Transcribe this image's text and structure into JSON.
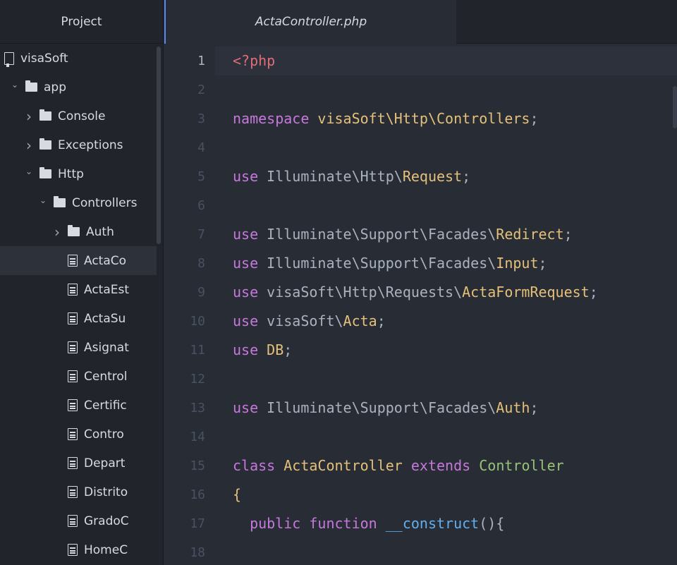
{
  "sidebar": {
    "title": "Project",
    "tree": [
      {
        "label": "visaSoft",
        "kind": "repo",
        "depth": 0,
        "expanded": null
      },
      {
        "label": "app",
        "kind": "folder",
        "depth": 1,
        "expanded": true
      },
      {
        "label": "Console",
        "kind": "folder",
        "depth": 2,
        "expanded": false
      },
      {
        "label": "Exceptions",
        "kind": "folder",
        "depth": 2,
        "expanded": false
      },
      {
        "label": "Http",
        "kind": "folder",
        "depth": 2,
        "expanded": true
      },
      {
        "label": "Controllers",
        "kind": "folder",
        "depth": 3,
        "expanded": true
      },
      {
        "label": "Auth",
        "kind": "folder",
        "depth": 4,
        "expanded": false
      },
      {
        "label": "ActaCo",
        "kind": "file",
        "depth": 4,
        "selected": true
      },
      {
        "label": "ActaEst",
        "kind": "file",
        "depth": 4
      },
      {
        "label": "ActaSu",
        "kind": "file",
        "depth": 4
      },
      {
        "label": "Asignat",
        "kind": "file",
        "depth": 4
      },
      {
        "label": "Centrol",
        "kind": "file",
        "depth": 4
      },
      {
        "label": "Certific",
        "kind": "file",
        "depth": 4
      },
      {
        "label": "Contro",
        "kind": "file",
        "depth": 4
      },
      {
        "label": "Depart",
        "kind": "file",
        "depth": 4
      },
      {
        "label": "Distrito",
        "kind": "file",
        "depth": 4
      },
      {
        "label": "GradoC",
        "kind": "file",
        "depth": 4
      },
      {
        "label": "HomeC",
        "kind": "file",
        "depth": 4
      }
    ]
  },
  "tabs": [
    {
      "label": "ActaController.php",
      "active": true
    }
  ],
  "editor": {
    "active_line": 1,
    "lines": [
      {
        "n": "1",
        "tokens": [
          {
            "t": "<?php",
            "c": "tag"
          }
        ]
      },
      {
        "n": "2",
        "tokens": []
      },
      {
        "n": "3",
        "tokens": [
          {
            "t": "namespace",
            "c": "kw"
          },
          {
            "t": " ",
            "c": "pl"
          },
          {
            "t": "visaSoft\\Http\\Controllers",
            "c": "cls"
          },
          {
            "t": ";",
            "c": "pl"
          }
        ]
      },
      {
        "n": "4",
        "tokens": []
      },
      {
        "n": "5",
        "tokens": [
          {
            "t": "use",
            "c": "kw"
          },
          {
            "t": " Illuminate\\Http\\",
            "c": "pl"
          },
          {
            "t": "Request",
            "c": "cls"
          },
          {
            "t": ";",
            "c": "pl"
          }
        ]
      },
      {
        "n": "6",
        "tokens": []
      },
      {
        "n": "7",
        "tokens": [
          {
            "t": "use",
            "c": "kw"
          },
          {
            "t": " Illuminate\\Support\\Facades\\",
            "c": "pl"
          },
          {
            "t": "Redirect",
            "c": "cls"
          },
          {
            "t": ";",
            "c": "pl"
          }
        ]
      },
      {
        "n": "8",
        "tokens": [
          {
            "t": "use",
            "c": "kw"
          },
          {
            "t": " Illuminate\\Support\\Facades\\",
            "c": "pl"
          },
          {
            "t": "Input",
            "c": "cls"
          },
          {
            "t": ";",
            "c": "pl"
          }
        ]
      },
      {
        "n": "9",
        "tokens": [
          {
            "t": "use",
            "c": "kw"
          },
          {
            "t": " visaSoft\\Http\\Requests\\",
            "c": "pl"
          },
          {
            "t": "ActaFormRequest",
            "c": "cls"
          },
          {
            "t": ";",
            "c": "pl"
          }
        ]
      },
      {
        "n": "10",
        "tokens": [
          {
            "t": "use",
            "c": "kw"
          },
          {
            "t": " visaSoft\\",
            "c": "pl"
          },
          {
            "t": "Acta",
            "c": "cls"
          },
          {
            "t": ";",
            "c": "pl"
          }
        ]
      },
      {
        "n": "11",
        "tokens": [
          {
            "t": "use",
            "c": "kw"
          },
          {
            "t": " ",
            "c": "pl"
          },
          {
            "t": "DB",
            "c": "cls"
          },
          {
            "t": ";",
            "c": "pl"
          }
        ]
      },
      {
        "n": "12",
        "tokens": []
      },
      {
        "n": "13",
        "tokens": [
          {
            "t": "use",
            "c": "kw"
          },
          {
            "t": " Illuminate\\Support\\Facades\\",
            "c": "pl"
          },
          {
            "t": "Auth",
            "c": "cls"
          },
          {
            "t": ";",
            "c": "pl"
          }
        ]
      },
      {
        "n": "14",
        "tokens": []
      },
      {
        "n": "15",
        "tokens": [
          {
            "t": "class",
            "c": "kw"
          },
          {
            "t": " ",
            "c": "pl"
          },
          {
            "t": "ActaController",
            "c": "cls"
          },
          {
            "t": " ",
            "c": "pl"
          },
          {
            "t": "extends",
            "c": "kw"
          },
          {
            "t": " ",
            "c": "pl"
          },
          {
            "t": "Controller",
            "c": "inh"
          }
        ]
      },
      {
        "n": "16",
        "tokens": [
          {
            "t": "{",
            "c": "cls"
          }
        ]
      },
      {
        "n": "17",
        "tokens": [
          {
            "t": "  ",
            "c": "pl"
          },
          {
            "t": "public",
            "c": "kw"
          },
          {
            "t": " ",
            "c": "pl"
          },
          {
            "t": "function",
            "c": "kw"
          },
          {
            "t": " ",
            "c": "pl"
          },
          {
            "t": "__construct",
            "c": "fn"
          },
          {
            "t": "(){",
            "c": "pl"
          }
        ]
      },
      {
        "n": "18",
        "tokens": []
      }
    ]
  },
  "colors": {
    "accent": "#568af2",
    "keyword": "#c678dd",
    "tag": "#e06c75",
    "class": "#e5c07b",
    "function": "#61afef",
    "inherited": "#98c379"
  },
  "icons": {
    "repo": "repo-icon",
    "folder": "folder-icon",
    "file": "file-text-icon",
    "chevron_open": "chevron-down-icon",
    "chevron_closed": "chevron-right-icon"
  }
}
